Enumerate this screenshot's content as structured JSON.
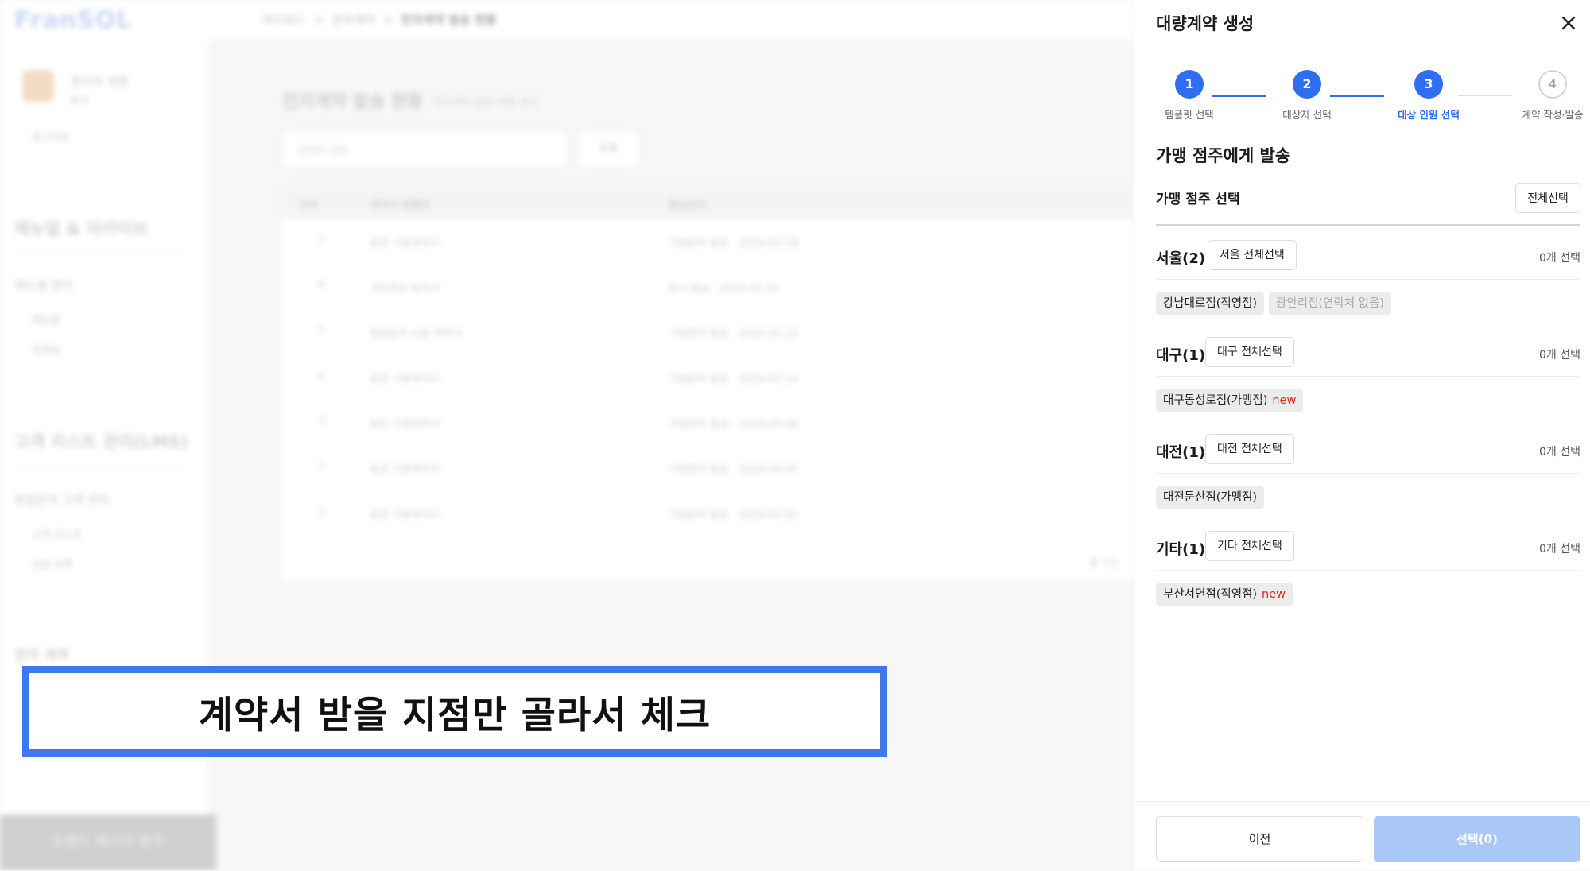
{
  "background": {
    "logo": "FranSOL",
    "breadcrumb": [
      "대시보드",
      "전자계약",
      "전자계약 발송 현황"
    ],
    "page_title": "전자계약 발송 현황",
    "page_subtitle": "전자계약 발송 현황 관리",
    "search_placeholder": "검색어 입력",
    "search_button": "조회",
    "user_name": "관리자 계정",
    "user_role": "본사",
    "logout": "로그아웃",
    "menu_section_1": "매뉴얼 & 아카이브",
    "menu_group_1": "매뉴얼 관리",
    "menu_items_1": [
      "매뉴얼",
      "자료실"
    ],
    "menu_section_2": "고객 리스트 관리(LMS)",
    "menu_group_2": "창업문의 고객 관리",
    "menu_items_2": [
      "고객 리스트",
      "상담 이력"
    ],
    "menu_section_3": "전자 계약",
    "cta": "프랜드 메시지 발주",
    "table_headers": [
      "번호",
      "계약서 템플릿",
      "발송일자"
    ],
    "table_rows": [
      {
        "no": "7",
        "template": "표준 가맹계약서",
        "date": "가맹본부 발송 · 2024.03.18"
      },
      {
        "no": "6",
        "template": "개인정보 동의서",
        "date": "본사 발송 · 2024.03.15"
      },
      {
        "no": "5",
        "template": "영업표지 사용 계약서",
        "date": "가맹본부 발송 · 2024.03.12"
      },
      {
        "no": "4",
        "template": "표준 가맹계약서",
        "date": "가맹본부 발송 · 2024.03.10"
      },
      {
        "no": "3",
        "template": "표준 가맹계약서",
        "date": "가맹본부 발송 · 2024.03.08"
      },
      {
        "no": "2",
        "template": "표준 가맹계약서",
        "date": "가맹본부 발송 · 2024.03.05"
      },
      {
        "no": "1",
        "template": "표준 가맹계약서",
        "date": "가맹본부 발송 · 2024.03.02"
      }
    ],
    "pagination": "총 7건"
  },
  "callout": {
    "text": "계약서 받을 지점만 골라서 체크",
    "border_color": "#3f78ed"
  },
  "panel": {
    "title": "대량계약 생성",
    "close_icon": "close-icon",
    "steps": [
      {
        "number": "1",
        "label": "템플릿 선택",
        "state": "done"
      },
      {
        "number": "2",
        "label": "대상자 선택",
        "state": "done"
      },
      {
        "number": "3",
        "label": "대상 인원 선택",
        "state": "current"
      },
      {
        "number": "4",
        "label": "계약 작성·발송",
        "state": "pending"
      }
    ],
    "section_title": "가맹 점주에게 발송",
    "subsection_title": "가맹 점주 선택",
    "select_all_label": "전체선택",
    "regions": [
      {
        "name": "서울(2)",
        "select_all": "서울 전체선택",
        "count": "0개 선택",
        "stores": [
          {
            "name": "강남대로점(직영점)",
            "new": "",
            "disabled": false
          },
          {
            "name": "광안리점(연락처 없음)",
            "new": "",
            "disabled": true
          }
        ]
      },
      {
        "name": "대구(1)",
        "select_all": "대구 전체선택",
        "count": "0개 선택",
        "stores": [
          {
            "name": "대구동성로점(가맹점)",
            "new": "new",
            "disabled": false
          }
        ]
      },
      {
        "name": "대전(1)",
        "select_all": "대전 전체선택",
        "count": "0개 선택",
        "stores": [
          {
            "name": "대전둔산점(가맹점)",
            "new": "",
            "disabled": false
          }
        ]
      },
      {
        "name": "기타(1)",
        "select_all": "기타 전체선택",
        "count": "0개 선택",
        "stores": [
          {
            "name": "부산서면점(직영점)",
            "new": "new",
            "disabled": false
          }
        ]
      }
    ],
    "prev_label": "이전",
    "next_label": "선택(0)",
    "colors": {
      "accent": "#2f6ef0",
      "new_badge": "#e5231b",
      "next_disabled": "#a9c7f7"
    }
  }
}
